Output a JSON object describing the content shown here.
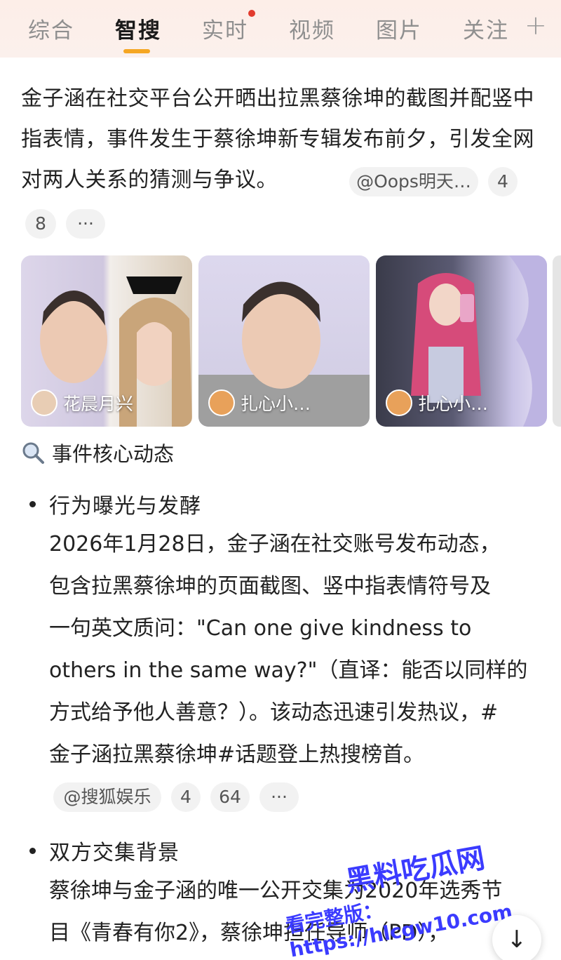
{
  "tabs": [
    {
      "label": "综合"
    },
    {
      "label": "智搜"
    },
    {
      "label": "实时"
    },
    {
      "label": "视频"
    },
    {
      "label": "图片"
    },
    {
      "label": "关注"
    }
  ],
  "active_tab": "智搜",
  "plus_label": "+",
  "summary": {
    "text": "金子涵在社交平台公开晒出拉黑蔡徐坤的截图并配竖中指表情，事件发生于蔡徐坤新专辑发布前夕，引发全网对两人关系的猜测与争议。",
    "source": "@Oops明天…",
    "count_a": "4",
    "count_b": "8",
    "more": "···"
  },
  "images": [
    {
      "source": "花晨月兴"
    },
    {
      "source": "扎心小…"
    },
    {
      "source": "扎心小…"
    }
  ],
  "section": {
    "icon": "search-icon",
    "heading": "事件核心动态"
  },
  "items": [
    {
      "title": "行为曝光与发酵",
      "lines": [
        "2026年1月28日，金子涵在社交账号发布动态，",
        "包含拉黑蔡徐坤的页面截图、竖中指表情符号及",
        "一句英文质问：\"Can one give kindness to",
        "others in the same way?\"（直译：能否以同样的",
        "方式给予他人善意？）。该动态迅速引发热议，#",
        "金子涵拉黑蔡徐坤#话题登上热搜榜首。"
      ],
      "source": "@搜狐娱乐",
      "count_a": "4",
      "count_b": "64",
      "more": "···"
    },
    {
      "title": "双方交集背景",
      "lines": [
        "蔡徐坤与金子涵的唯一公开交集为2020年选秀节",
        "目《青春有你2》，蔡徐坤担任导师（PD），"
      ]
    }
  ],
  "watermark": {
    "line1": "黑料吃瓜网",
    "line2": "看完整版：https://hlcgw10.com"
  },
  "colors": {
    "accent": "#f5a623",
    "notification_dot": "#e23b2e",
    "watermark": "#3b3bff"
  }
}
